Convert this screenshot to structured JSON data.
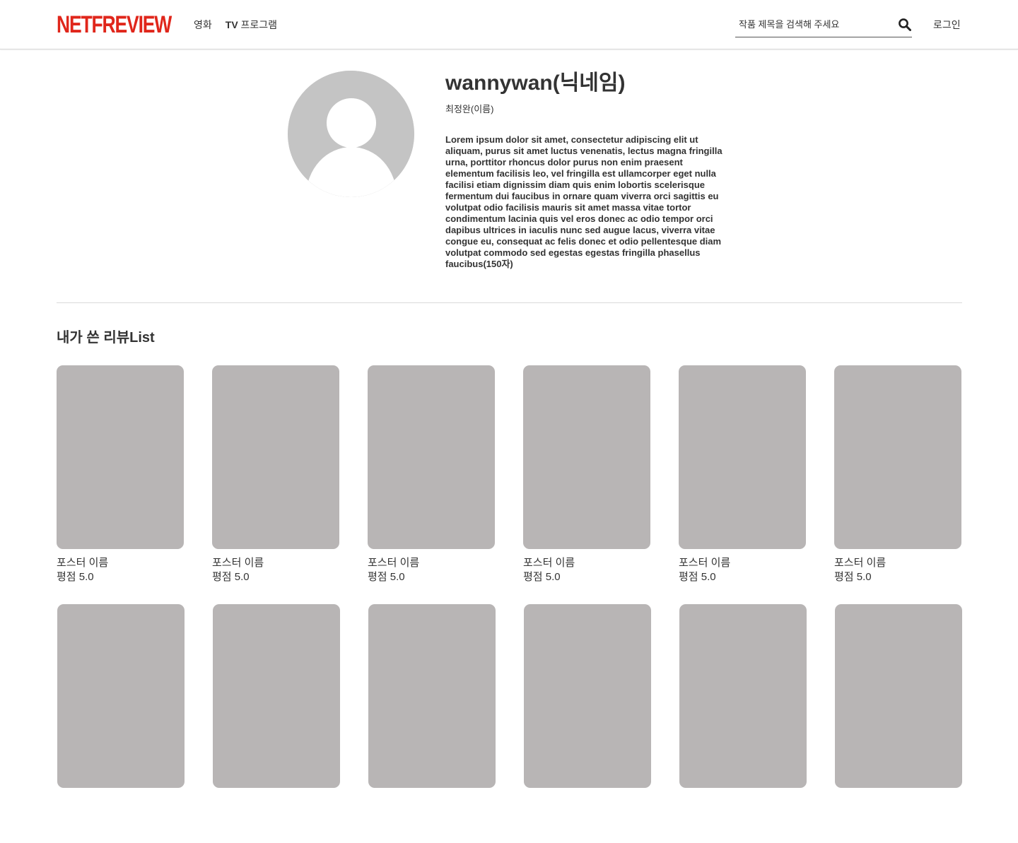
{
  "colors": {
    "brand": "#e0261b",
    "poster_placeholder": "#b8b5b5",
    "avatar_placeholder": "#c4c4c4"
  },
  "header": {
    "logo": "NETFREVIEW",
    "nav": [
      {
        "label": "영화"
      },
      {
        "label_prefix": "TV",
        "label_suffix": " 프로그램"
      }
    ],
    "search": {
      "placeholder": "작품 제목을 검색해 주세요",
      "icon": "search-icon"
    },
    "login": "로그인"
  },
  "profile": {
    "avatar_icon": "user-avatar-icon",
    "nickname": "wannywan(닉네임)",
    "name": "최정완(이름)",
    "bio": "Lorem ipsum dolor sit amet, consectetur adipiscing elit ut aliquam, purus sit amet luctus venenatis, lectus magna fringilla urna, porttitor rhoncus dolor purus non enim praesent elementum facilisis leo, vel fringilla est ullamcorper eget nulla facilisi etiam dignissim diam quis enim lobortis scelerisque fermentum dui faucibus in ornare quam viverra orci sagittis eu volutpat odio facilisis mauris sit amet massa vitae tortor condimentum lacinia quis vel eros donec ac odio tempor orci dapibus ultrices in iaculis nunc sed augue lacus, viverra vitae congue eu, consequat ac felis donec et odio pellentesque diam volutpat commodo sed egestas egestas fringilla phasellus faucibus(150자)"
  },
  "reviews": {
    "title": "내가 쓴 리뷰List",
    "items": [
      {
        "title": "포스터 이름",
        "rating": "평점 5.0"
      },
      {
        "title": "포스터 이름",
        "rating": "평점 5.0"
      },
      {
        "title": "포스터 이름",
        "rating": "평점 5.0"
      },
      {
        "title": "포스터 이름",
        "rating": "평점 5.0"
      },
      {
        "title": "포스터 이름",
        "rating": "평점 5.0"
      },
      {
        "title": "포스터 이름",
        "rating": "평점 5.0"
      },
      {
        "title": "",
        "rating": ""
      },
      {
        "title": "",
        "rating": ""
      },
      {
        "title": "",
        "rating": ""
      },
      {
        "title": "",
        "rating": ""
      },
      {
        "title": "",
        "rating": ""
      },
      {
        "title": "",
        "rating": ""
      }
    ]
  }
}
